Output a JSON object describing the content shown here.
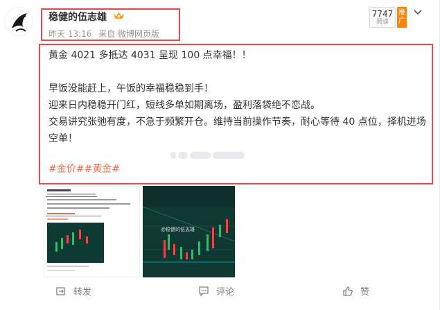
{
  "post": {
    "author": "稳健的伍志雄",
    "time": "昨天 13:16",
    "source": "来自 微博网页版",
    "read_count": "7747",
    "read_label": "阅读",
    "promote_label": "推广",
    "content": {
      "line1": "黄金 4021 多抵达 4031 呈现 100 点幸福！！",
      "line2": "早饭没能赶上，午饭的幸福稳稳到手！",
      "line3": "迎来日内稳稳开门红，短线多单如期离场，盈利落袋绝不恋战。",
      "line4": "交易讲究张弛有度，不急于频繁开仓。维持当前操作节奏，耐心等待 40 点位，择机进场空单！",
      "tags": "#金价##黄金#"
    },
    "images": {
      "img2_watermark": "@稳健的伍志雄"
    }
  },
  "actions": {
    "repost": "转发",
    "comment": "评论",
    "like": "赞"
  },
  "colors": {
    "highlight_border": "#e5484d",
    "tag": "#eb7350",
    "promote": "#ff8200"
  },
  "icons": [
    "avatar",
    "vip-crown-icon",
    "chevron-down-icon",
    "repost-icon",
    "comment-icon",
    "like-icon"
  ]
}
